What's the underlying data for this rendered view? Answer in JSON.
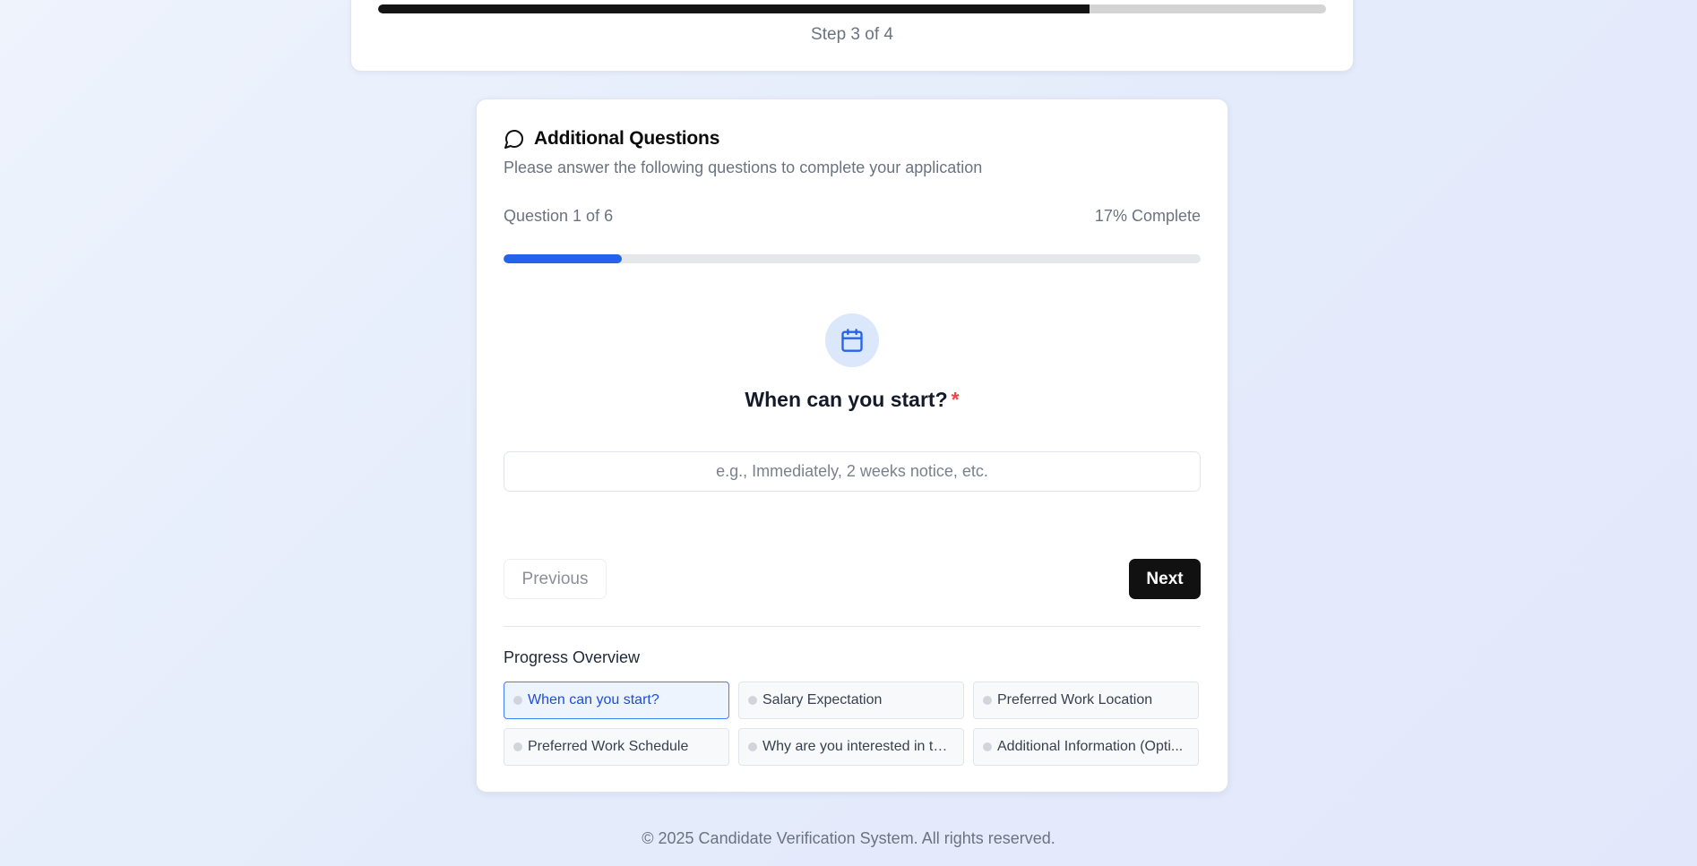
{
  "stepper": {
    "text": "Step 3 of 4",
    "progress_percent": 75
  },
  "card": {
    "title": "Additional Questions",
    "subtitle": "Please answer the following questions to complete your application",
    "title_icon": "message-circle-icon"
  },
  "question_progress": {
    "counter": "Question 1 of 6",
    "complete": "17% Complete",
    "progress_percent": 17
  },
  "question": {
    "icon": "calendar-icon",
    "label": "When can you start?",
    "required_mark": "*",
    "input_placeholder": "e.g., Immediately, 2 weeks notice, etc.",
    "input_value": ""
  },
  "nav": {
    "previous_label": "Previous",
    "next_label": "Next"
  },
  "overview": {
    "title": "Progress Overview",
    "items": [
      {
        "label": "When can you start?",
        "active": true
      },
      {
        "label": "Salary Expectation",
        "active": false
      },
      {
        "label": "Preferred Work Location",
        "active": false
      },
      {
        "label": "Preferred Work Schedule",
        "active": false
      },
      {
        "label": "Why are you interested in thi...",
        "active": false
      },
      {
        "label": "Additional Information (Opti...",
        "active": false
      }
    ]
  },
  "footer": {
    "text": "© 2025 Candidate Verification System. All rights reserved."
  },
  "colors": {
    "accent": "#2563eb",
    "primary_button": "#111111",
    "required": "#ef4444",
    "step_fill": "#141414"
  }
}
